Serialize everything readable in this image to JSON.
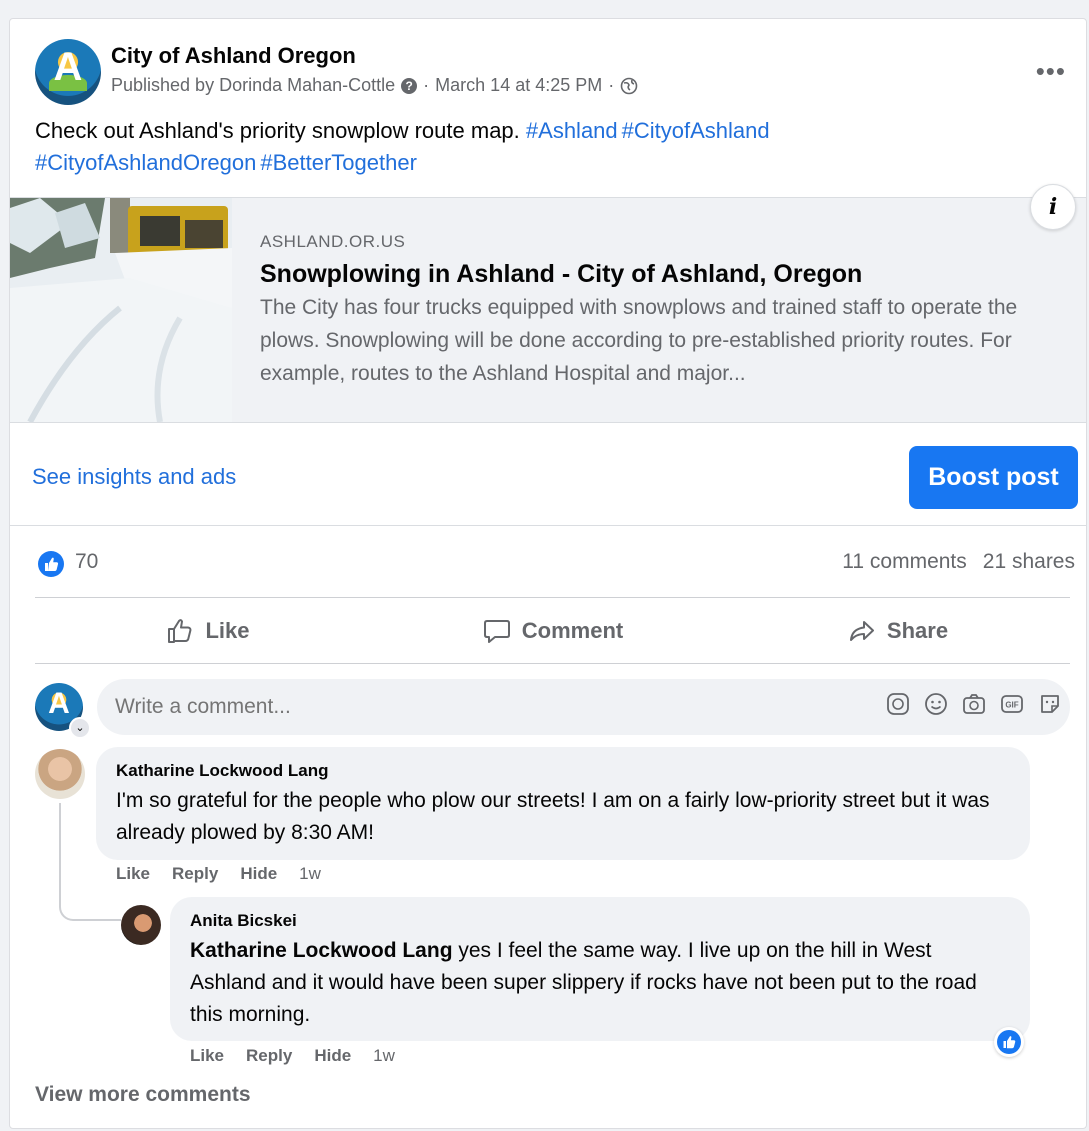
{
  "post": {
    "page_name": "City of Ashland Oregon",
    "published_by": "Published by Dorinda Mahan-Cottle",
    "date": "March 14 at 4:25 PM",
    "more_label": "•••",
    "text": "Check out Ashland's priority snowplow route map.",
    "hashtags": [
      "#Ashland",
      "#CityofAshland",
      "#CityofAshlandOregon",
      "#BetterTogether"
    ]
  },
  "link_preview": {
    "domain": "ASHLAND.OR.US",
    "title": "Snowplowing in Ashland - City of Ashland, Oregon",
    "description": "The City has four trucks equipped with snowplows and trained staff to operate the plows. Snowplowing will be done according to pre-established priority routes. For example, routes to the Ashland Hospital and major...",
    "info_label": "i"
  },
  "insights": {
    "link_label": "See insights and ads",
    "boost_label": "Boost post"
  },
  "stats": {
    "likes": "70",
    "comments": "11 comments",
    "shares": "21 shares"
  },
  "actions": {
    "like": "Like",
    "comment": "Comment",
    "share": "Share"
  },
  "composer": {
    "placeholder": "Write a comment..."
  },
  "comments": [
    {
      "author": "Katharine Lockwood Lang",
      "text": "I'm so grateful for the people who plow our streets! I am on a fairly low-priority street but it was already plowed by 8:30 AM!",
      "actions": {
        "like": "Like",
        "reply": "Reply",
        "hide": "Hide",
        "time": "1w"
      }
    },
    {
      "author": "Anita Bicskei",
      "mention": "Katharine Lockwood Lang",
      "text": " yes I feel the same way. I live up on the hill in West Ashland and it would have been super slippery if rocks have not been put to the road this morning.",
      "actions": {
        "like": "Like",
        "reply": "Reply",
        "hide": "Hide",
        "time": "1w"
      }
    }
  ],
  "view_more": "View more comments",
  "colors": {
    "link_blue": "#216fdb",
    "brand_blue": "#1877f2",
    "muted_text": "#65676b",
    "bubble_bg": "#f0f2f5"
  }
}
